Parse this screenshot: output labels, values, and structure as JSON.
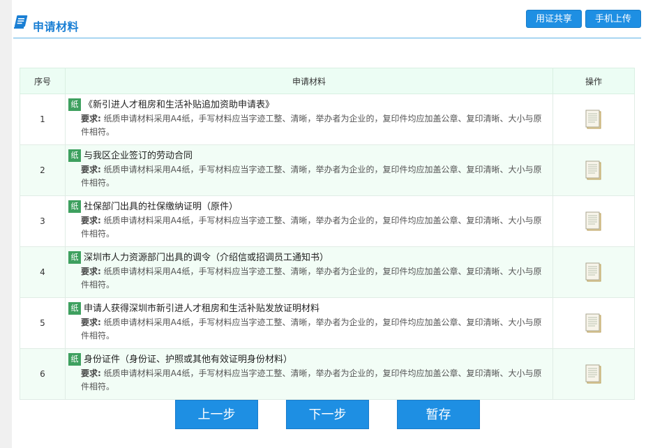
{
  "header": {
    "title": "申请材料",
    "share_label": "用证共享",
    "upload_label": "手机上传"
  },
  "table": {
    "columns": [
      "序号",
      "申请材料",
      "操作"
    ],
    "rows": [
      {
        "num": "1",
        "badge": "纸",
        "title": "《新引进人才租房和生活补贴追加资助申请表》",
        "req_label": "要求:",
        "req_text": "纸质申请材料采用A4纸，手写材料应当字迹工整、清晰，举办者为企业的，复印件均应加盖公章、复印清晰、大小与原件相符。"
      },
      {
        "num": "2",
        "badge": "纸",
        "title": "与我区企业签订的劳动合同",
        "req_label": "要求:",
        "req_text": "纸质申请材料采用A4纸，手写材料应当字迹工整、清晰，举办者为企业的，复印件均应加盖公章、复印清晰、大小与原件相符。"
      },
      {
        "num": "3",
        "badge": "纸",
        "title": "社保部门出具的社保缴纳证明（原件）",
        "req_label": "要求:",
        "req_text": "纸质申请材料采用A4纸，手写材料应当字迹工整、清晰，举办者为企业的，复印件均应加盖公章、复印清晰、大小与原件相符。"
      },
      {
        "num": "4",
        "badge": "纸",
        "title": "深圳市人力资源部门出具的调令（介绍信或招调员工通知书）",
        "req_label": "要求:",
        "req_text": "纸质申请材料采用A4纸，手写材料应当字迹工整、清晰，举办者为企业的，复印件均应加盖公章、复印清晰、大小与原件相符。"
      },
      {
        "num": "5",
        "badge": "纸",
        "title": "申请人获得深圳市新引进人才租房和生活补贴发放证明材料",
        "req_label": "要求:",
        "req_text": "纸质申请材料采用A4纸，手写材料应当字迹工整、清晰，举办者为企业的，复印件均应加盖公章、复印清晰、大小与原件相符。"
      },
      {
        "num": "6",
        "badge": "纸",
        "title": "身份证件（身份证、护照或其他有效证明身份材料）",
        "req_label": "要求:",
        "req_text": "纸质申请材料采用A4纸，手写材料应当字迹工整、清晰，举办者为企业的，复印件均应加盖公章、复印清晰、大小与原件相符。"
      }
    ]
  },
  "footer": {
    "prev_label": "上一步",
    "next_label": "下一步",
    "save_label": "暂存"
  },
  "colors": {
    "accent": "#1e8fe3",
    "badge": "#3ea05f",
    "row_alt": "#f2fdf6",
    "header_row": "#ecfdf4"
  }
}
